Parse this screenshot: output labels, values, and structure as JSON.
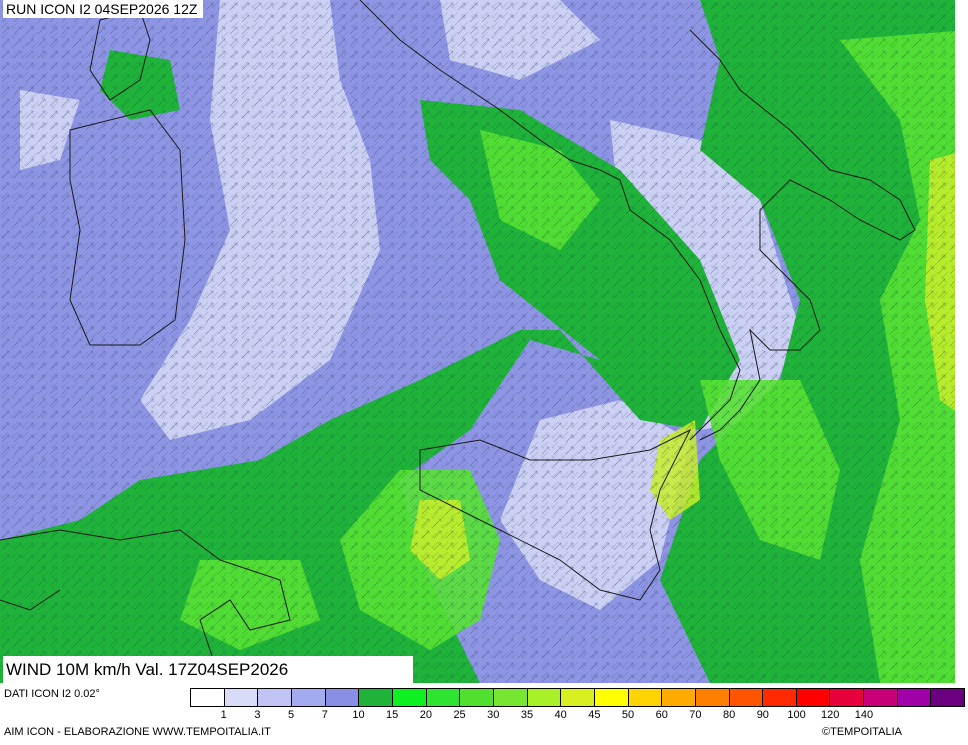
{
  "header": {
    "run_label": "RUN ICON I2 04SEP2026 12Z"
  },
  "title": {
    "text": "WIND 10M km/h Val. 17Z04SEP2026"
  },
  "footer": {
    "data_source": "DATI ICON I2 0.02°",
    "elaboration": "AIM ICON - ELABORAZIONE WWW.TEMPOITALIA.IT",
    "copyright": "©TEMPOITALIA"
  },
  "legend": {
    "colors": [
      "#ffffff",
      "#d8dcf8",
      "#c0c4f4",
      "#a4aaee",
      "#8a8fe6",
      "#1fb33a",
      "#0ef020",
      "#2de530",
      "#52e030",
      "#76e630",
      "#a8f028",
      "#d8f020",
      "#ffff00",
      "#ffd400",
      "#ffaa00",
      "#ff7f00",
      "#ff5500",
      "#ff2a00",
      "#ff0000",
      "#e8003c",
      "#c80078",
      "#a000a8",
      "#6a0080"
    ],
    "ticks": [
      "1",
      "3",
      "5",
      "7",
      "10",
      "15",
      "20",
      "25",
      "30",
      "35",
      "40",
      "45",
      "50",
      "60",
      "70",
      "80",
      "90",
      "100",
      "120",
      "140"
    ]
  },
  "map": {
    "sea_color": "#8e95e4",
    "calm_color": "#d6dbf7",
    "wind_green": "#1fb33a",
    "wind_light_green": "#57e234",
    "wind_yellow": "#c8ee2c"
  }
}
